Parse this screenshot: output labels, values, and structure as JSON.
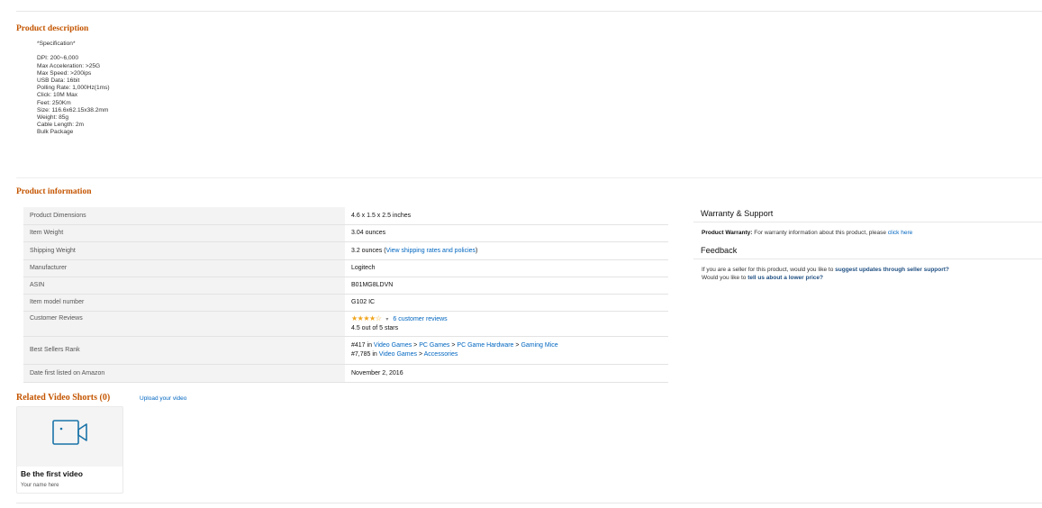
{
  "description": {
    "heading": "Product description",
    "lines": [
      "*Specification*",
      "",
      "DPI: 200~6,000",
      "Max Acceleration: >25G",
      "Max Speed: >200ips",
      "USB Data: 16bit",
      "Polling Rate: 1,000Hz(1ms)",
      "Click: 10M Max",
      "Feet: 250Km",
      "Size: 116.6x62.15x38.2mm",
      "Weight: 85g",
      "Cable Length: 2m",
      "Bulk Package"
    ]
  },
  "info": {
    "heading": "Product information",
    "rows": [
      {
        "key": "Product Dimensions",
        "value": "4.6 x 1.5 x 2.5 inches"
      },
      {
        "key": "Item Weight",
        "value": "3.04 ounces"
      },
      {
        "key": "Shipping Weight",
        "value": "3.2 ounces",
        "link": "View shipping rates and policies"
      },
      {
        "key": "Manufacturer",
        "value": "Logitech"
      },
      {
        "key": "ASIN",
        "value": "B01MG8LDVN"
      },
      {
        "key": "Item model number",
        "value": "G102 IC"
      },
      {
        "key": "Customer Reviews",
        "stars": "★★★★☆",
        "reviews_link": "6 customer reviews",
        "rating_text": "4.5 out of 5 stars",
        "rating": 4.5
      },
      {
        "key": "Best Sellers Rank",
        "rank1_prefix": "#417 in ",
        "rank1_links": [
          "Video Games",
          "PC Games",
          "PC Game Hardware",
          "Gaming Mice"
        ],
        "rank2_prefix": "#7,785 in ",
        "rank2_links": [
          "Video Games",
          "Accessories"
        ]
      },
      {
        "key": "Date first listed on Amazon",
        "value": "November 2, 2016"
      }
    ]
  },
  "warranty": {
    "title": "Warranty & Support",
    "label": "Product Warranty:",
    "text": " For warranty information about this product, please ",
    "link": "click here"
  },
  "feedback": {
    "title": "Feedback",
    "line1_text": "If you are a seller for this product, would you like to ",
    "line1_link": "suggest updates through seller support?",
    "line2_text": "Would you like to ",
    "line2_link": "tell us about a lower price?"
  },
  "video_shorts": {
    "title": "Related Video Shorts (0)",
    "upload_link": "Upload your video",
    "card_title": "Be the first video",
    "card_sub": "Your name here",
    "icon": "video-camera-icon"
  },
  "colors": {
    "section_heading": "#c45500",
    "link": "#0066c0",
    "star": "#f0a41c"
  }
}
